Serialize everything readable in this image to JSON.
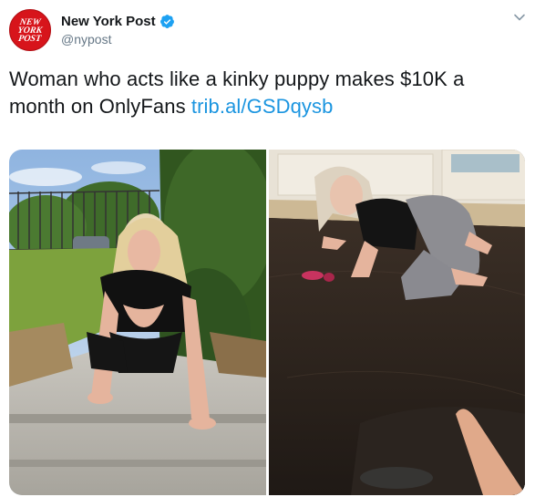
{
  "account": {
    "display_name": "New York Post",
    "handle": "@nypost",
    "avatar_logo_text": [
      "NEW",
      "YORK",
      "POST"
    ],
    "verified": true
  },
  "tweet": {
    "text": "Woman who acts like a kinky puppy makes $10K a month on OnlyFans ",
    "link_text": "trib.al/GSDqysb"
  },
  "media": {
    "photos": [
      {
        "icon": "photo-outdoor-steps"
      },
      {
        "icon": "photo-indoor-floor"
      }
    ]
  },
  "colors": {
    "link": "#1b95e0",
    "verified_badge": "#1da1f2",
    "brand_red": "#d7141b",
    "handle_gray": "#657786"
  }
}
